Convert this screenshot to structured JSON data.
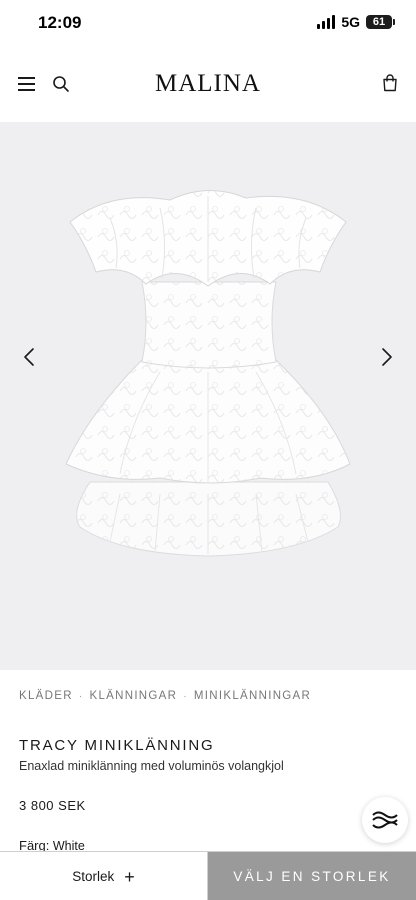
{
  "status_bar": {
    "time": "12:09",
    "network": "5G",
    "battery": "61"
  },
  "header": {
    "logo": "MALINA",
    "icons": [
      "menu-icon",
      "search-icon",
      "shopping-bag-icon"
    ]
  },
  "gallery": {
    "icons": [
      "chevron-left-icon",
      "chevron-right-icon"
    ]
  },
  "breadcrumb": [
    "KLÄDER",
    "KLÄNNINGAR",
    "MINIKLÄNNINGAR"
  ],
  "product": {
    "title": "TRACY MINIKLÄNNING",
    "description": "Enaxlad miniklänning med voluminös volangkjol",
    "price": "3 800 SEK",
    "color_label": "Färg:",
    "color_value": "White"
  },
  "bottom_bar": {
    "size_label": "Storlek",
    "size_plus": "+",
    "choose_size_label": "VÄLJ EN STORLEK"
  },
  "colors": {
    "gallery_bg": "#efeff1",
    "choose_button_bg": "#9a9a9a"
  }
}
